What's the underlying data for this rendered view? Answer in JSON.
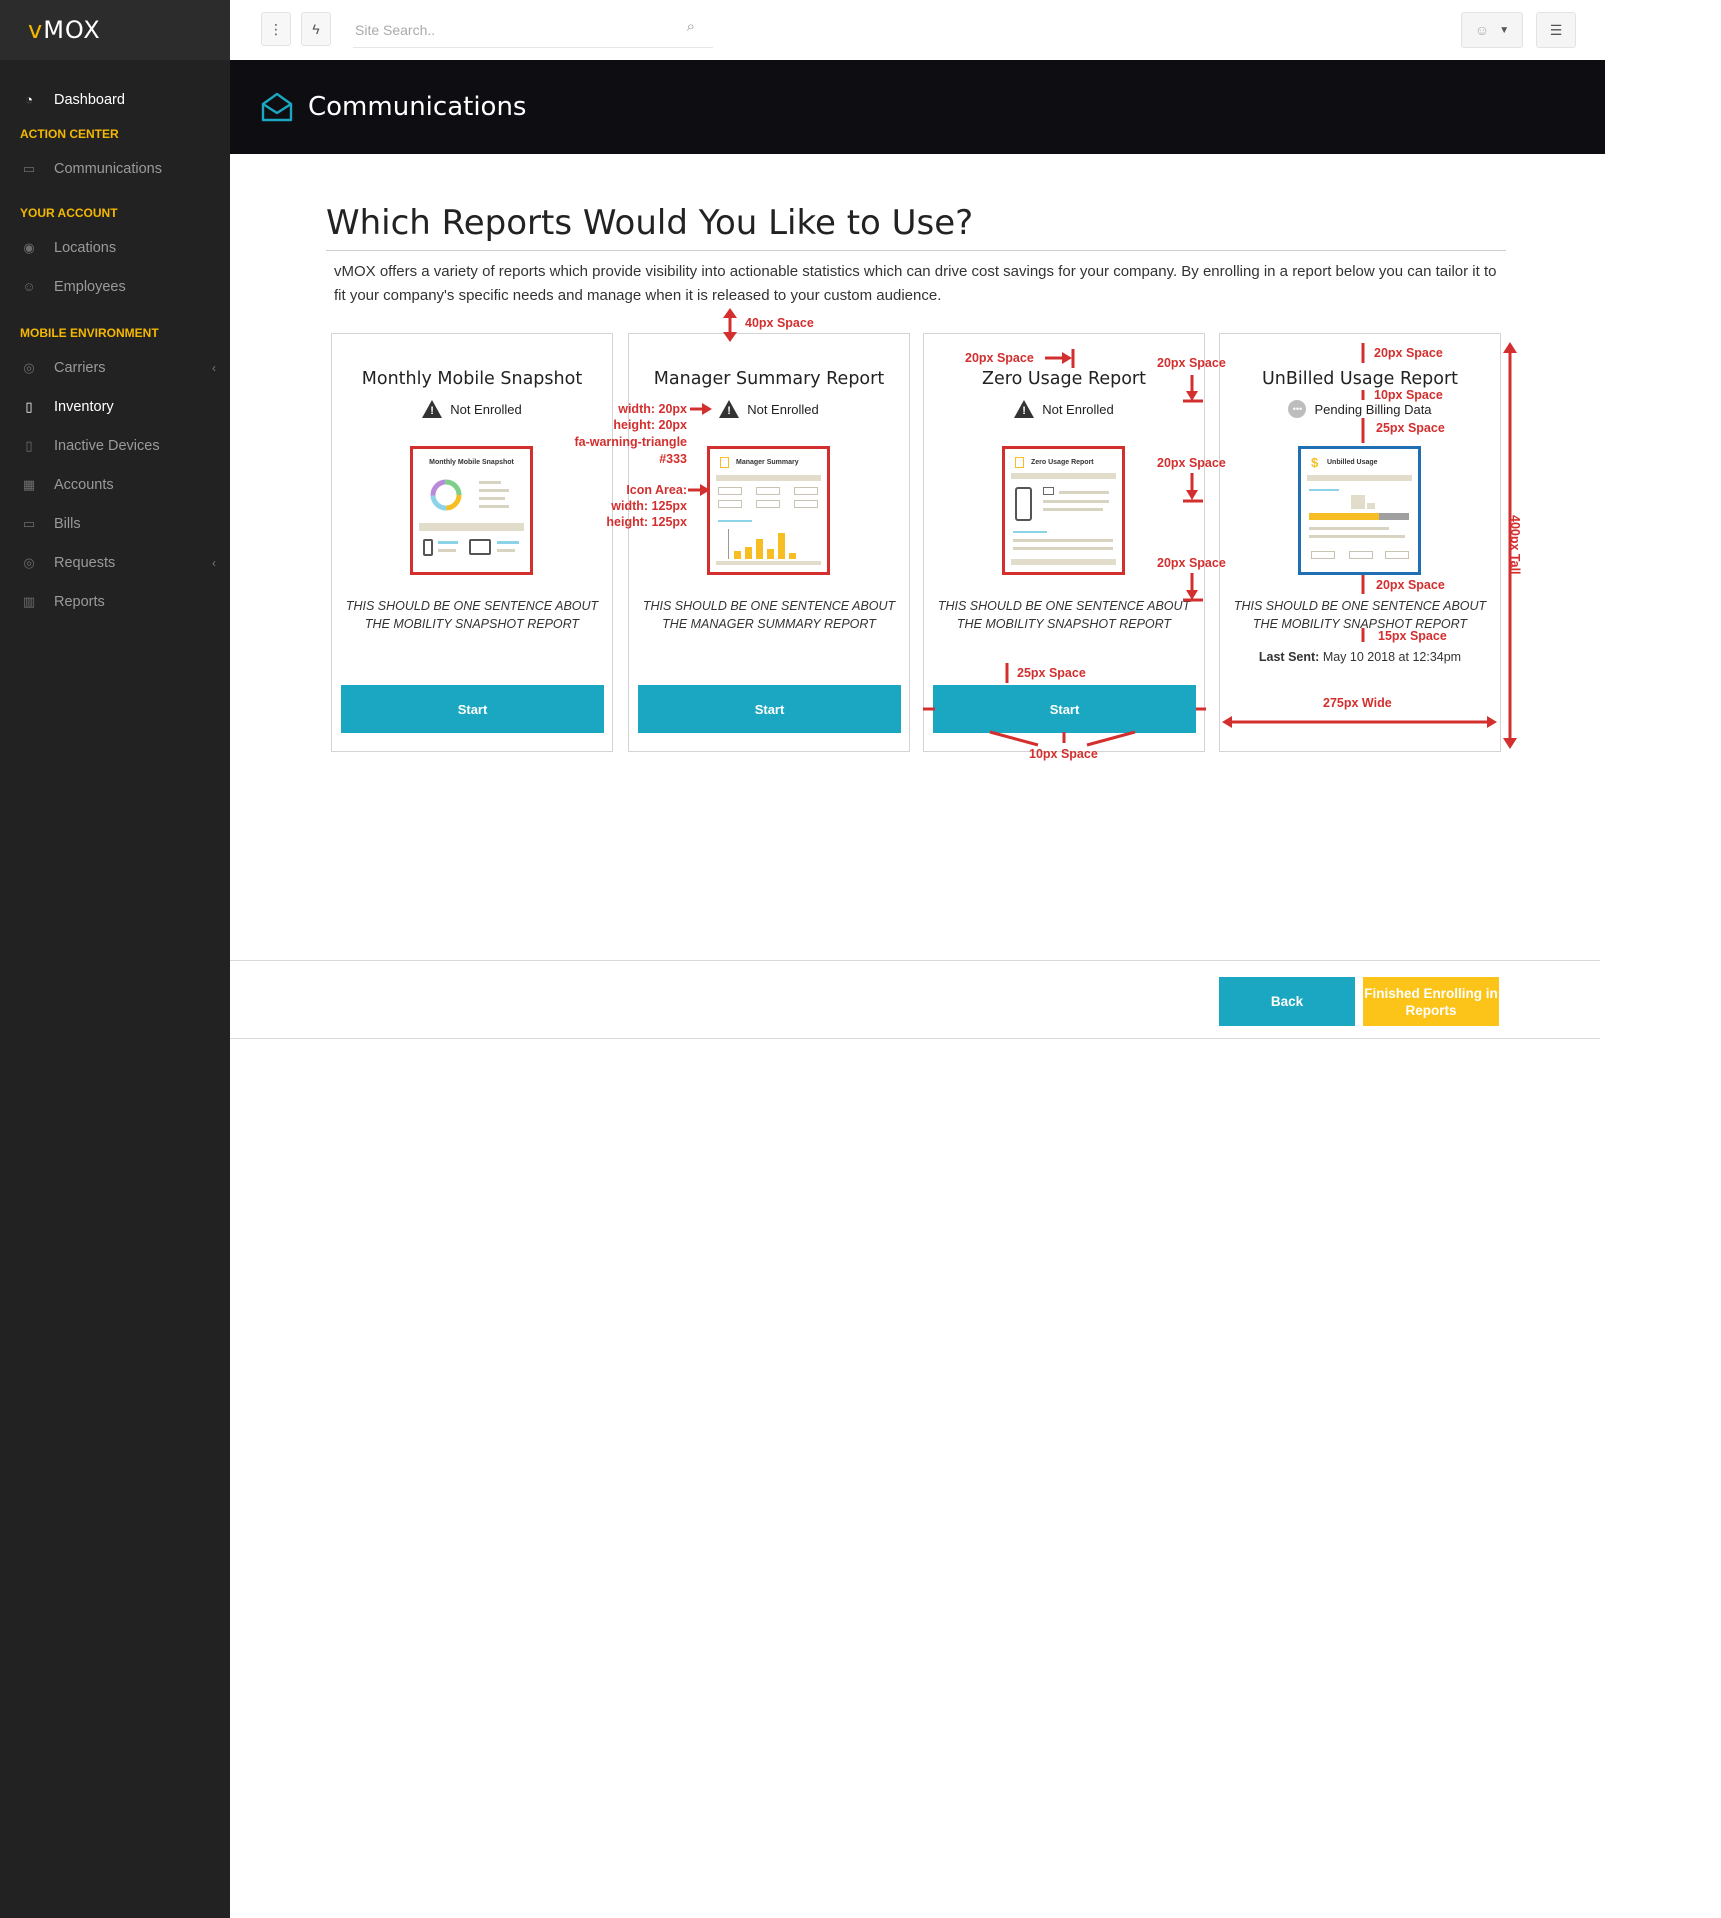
{
  "sidebar": {
    "logo_v": "v",
    "logo_rest": "MOX",
    "dashboard": "Dashboard",
    "section_action": "ACTION CENTER",
    "communications": "Communications",
    "section_account": "YOUR ACCOUNT",
    "locations": "Locations",
    "employees": "Employees",
    "section_mobile": "MOBILE ENVIRONMENT",
    "carriers": "Carriers",
    "inventory": "Inventory",
    "inactive_devices": "Inactive Devices",
    "accounts": "Accounts",
    "bills": "Bills",
    "requests": "Requests",
    "reports": "Reports"
  },
  "topbar": {
    "search_placeholder": "Site Search.."
  },
  "header": {
    "title": "Communications"
  },
  "main": {
    "title": "Which Reports Would You Like to Use?",
    "intro": "vMOX offers a variety of reports which provide visibility into actionable statistics which can drive cost savings for your company.  By enrolling in a report below you can tailor it to fit your company's specific needs and manage when it is released to your custom audience."
  },
  "cards": [
    {
      "title": "Monthly Mobile Snapshot",
      "status": "Not Enrolled",
      "thumb_title": "Monthly Mobile Snapshot",
      "description": "THIS SHOULD BE ONE SENTENCE ABOUT THE MOBILITY SNAPSHOT REPORT",
      "button": "Start"
    },
    {
      "title": "Manager Summary Report",
      "status": "Not Enrolled",
      "thumb_title": "Manager Summary",
      "description": "THIS SHOULD BE ONE SENTENCE ABOUT THE MANAGER SUMMARY REPORT",
      "button": "Start"
    },
    {
      "title": "Zero Usage Report",
      "status": "Not Enrolled",
      "thumb_title": "Zero Usage Report",
      "description": "THIS SHOULD BE ONE SENTENCE ABOUT THE MOBILITY SNAPSHOT REPORT",
      "button": "Start"
    },
    {
      "title": "UnBilled Usage Report",
      "status": "Pending Billing Data",
      "thumb_title": "Unbilled Usage",
      "description": "THIS SHOULD BE ONE SENTENCE ABOUT THE MOBILITY SNAPSHOT REPORT",
      "last_sent_label": "Last Sent:",
      "last_sent_value": "May 10 2018 at 12:34pm"
    }
  ],
  "footer": {
    "back": "Back",
    "finish": "Finished Enrolling in Reports"
  },
  "annotations": {
    "space_40": "40px Space",
    "width_20": "width: 20px",
    "height_20": "height: 20px",
    "fa_warning": "fa-warning-triangle",
    "color_333": "#333",
    "icon_area": "Icon Area:",
    "width_125": "width: 125px",
    "height_125": "height: 125px",
    "space_20": "20px Space",
    "space_10": "10px Space",
    "space_25": "25px Space",
    "space_15": "15px Space",
    "wide_275": "275px Wide",
    "tall_400": "400px Tall"
  },
  "colors": {
    "accent": "#1ba7c1",
    "brand_yellow": "#f5b800",
    "finish_button": "#fcc419",
    "annotation_red": "#d32f2f",
    "sidebar_bg": "#222222",
    "header_bg": "#0d0d12"
  }
}
